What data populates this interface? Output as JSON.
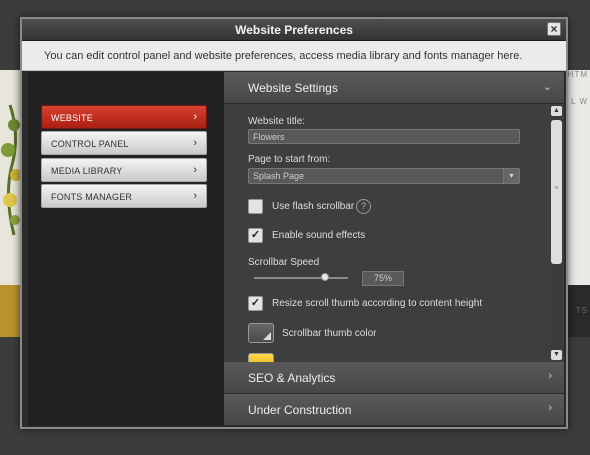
{
  "dialog": {
    "title": "Website Preferences",
    "close_icon": "close-icon",
    "info": "You can edit control panel and website preferences, access media library and fonts manager here."
  },
  "background": {
    "right_text_1": "HTM",
    "right_text_2": "L W",
    "right_text_3": "TS"
  },
  "nav": {
    "items": [
      {
        "label": "WEBSITE",
        "active": true
      },
      {
        "label": "CONTROL PANEL",
        "active": false
      },
      {
        "label": "MEDIA LIBRARY",
        "active": false
      },
      {
        "label": "FONTS MANAGER",
        "active": false
      }
    ],
    "chevron": "›"
  },
  "sections": {
    "website_settings": "Website Settings",
    "seo": "SEO & Analytics",
    "under_construction": "Under Construction"
  },
  "website": {
    "title_label": "Website title:",
    "title_value": "Flowers",
    "start_label": "Page to start from:",
    "start_value": "Splash Page",
    "flash_scrollbar_label": "Use flash scrollbar",
    "flash_scrollbar_checked": false,
    "sound_label": "Enable sound effects",
    "sound_checked": true,
    "speed_label": "Scrollbar Speed",
    "speed_value": "75%",
    "speed_fraction": 0.75,
    "resize_label": "Resize scroll thumb according to content height",
    "resize_checked": true,
    "thumb_color_label": "Scrollbar thumb color",
    "help_glyph": "?",
    "check_glyph": "✓"
  },
  "colors": {
    "accent": "#c0291b",
    "thumb_swatch": "#555555",
    "yellow_swatch": "#f2c21b"
  }
}
